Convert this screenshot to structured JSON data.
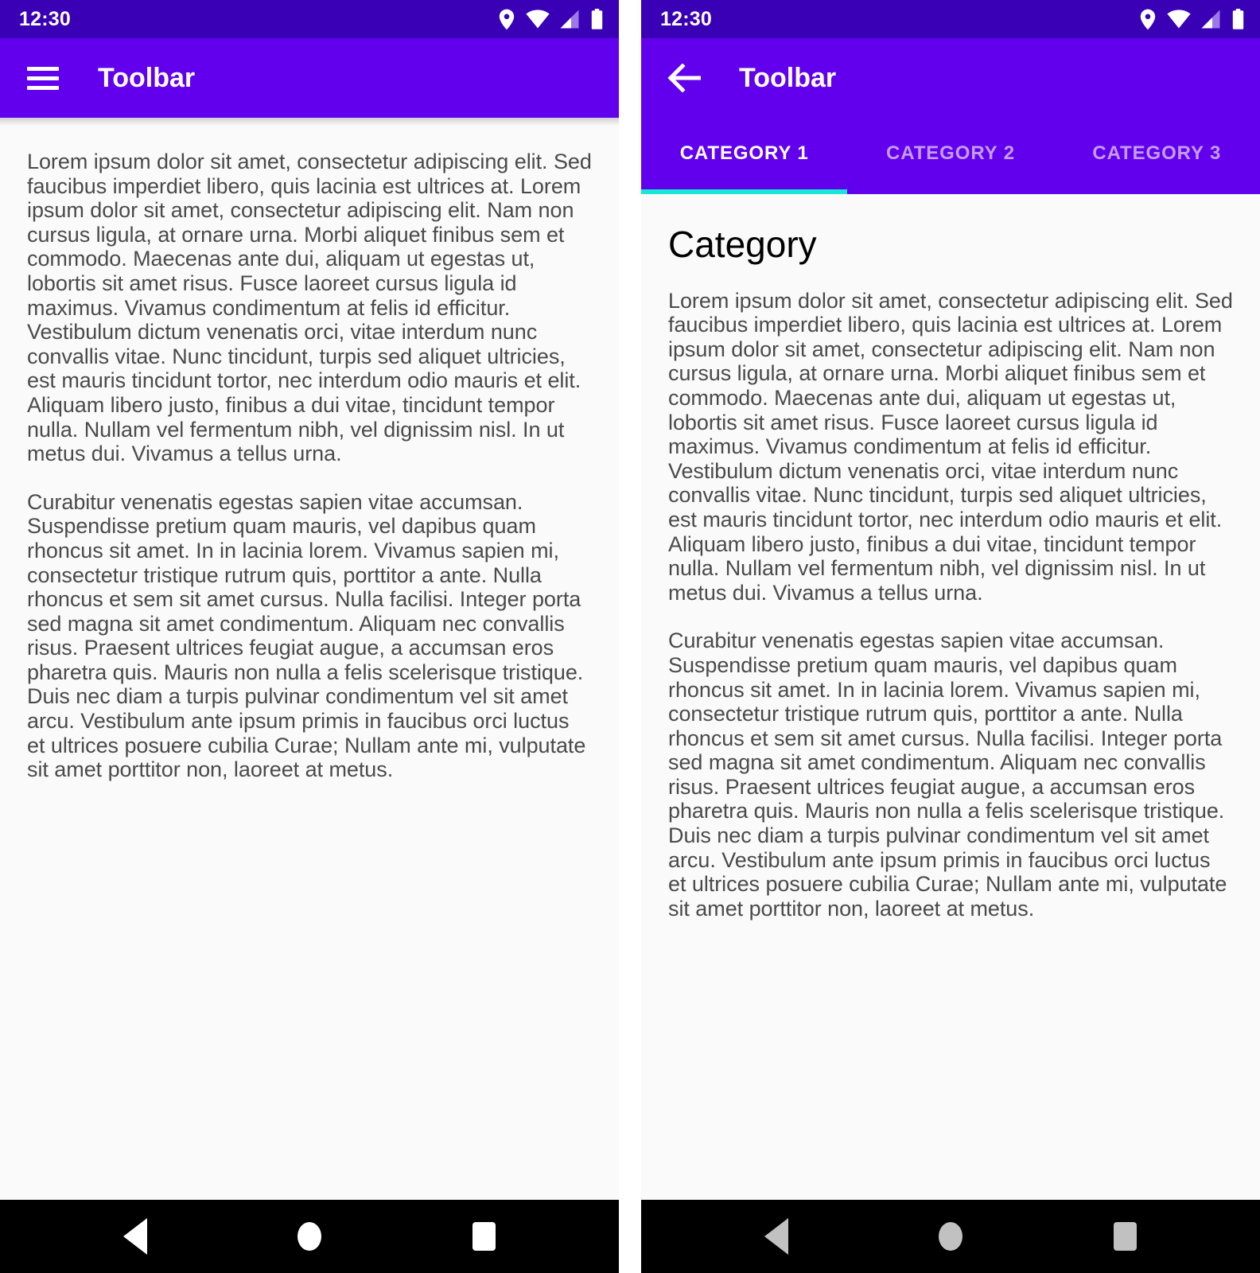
{
  "status_bar": {
    "time": "12:30",
    "icons": [
      "location-pin-icon",
      "wifi-icon",
      "cell-signal-icon",
      "battery-icon"
    ]
  },
  "left_screen": {
    "toolbar": {
      "menu_icon": "hamburger-menu-icon",
      "title": "Toolbar"
    },
    "paragraphs": [
      "Lorem ipsum dolor sit amet, consectetur adipiscing elit. Sed faucibus imperdiet libero, quis lacinia est ultrices at. Lorem ipsum dolor sit amet, consectetur adipiscing elit. Nam non cursus ligula, at ornare urna. Morbi aliquet finibus sem et commodo. Maecenas ante dui, aliquam ut egestas ut, lobortis sit amet risus. Fusce laoreet cursus ligula id maximus. Vivamus condimentum at felis id efficitur. Vestibulum dictum venenatis orci, vitae interdum nunc convallis vitae. Nunc tincidunt, turpis sed aliquet ultricies, est mauris tincidunt tortor, nec interdum odio mauris et elit. Aliquam libero justo, finibus a dui vitae, tincidunt tempor nulla. Nullam vel fermentum nibh, vel dignissim nisl. In ut metus dui. Vivamus a tellus urna.",
      "Curabitur venenatis egestas sapien vitae accumsan. Suspendisse pretium quam mauris, vel dapibus quam rhoncus sit amet. In in lacinia lorem. Vivamus sapien mi, consectetur tristique rutrum quis, porttitor a ante. Nulla rhoncus et sem sit amet cursus. Nulla facilisi. Integer porta sed magna sit amet condimentum. Aliquam nec convallis risus. Praesent ultrices feugiat augue, a accumsan eros pharetra quis. Mauris non nulla a felis scelerisque tristique. Duis nec diam a turpis pulvinar condimentum vel sit amet arcu. Vestibulum ante ipsum primis in faucibus orci luctus et ultrices posuere cubilia Curae; Nullam ante mi, vulputate sit amet porttitor non, laoreet at metus."
    ]
  },
  "right_screen": {
    "toolbar": {
      "back_icon": "arrow-back-icon",
      "title": "Toolbar"
    },
    "tabs": [
      {
        "label": "CATEGORY 1",
        "active": true
      },
      {
        "label": "CATEGORY 2",
        "active": false
      },
      {
        "label": "CATEGORY 3",
        "active": false
      }
    ],
    "heading": "Category",
    "paragraphs": [
      "Lorem ipsum dolor sit amet, consectetur adipiscing elit. Sed faucibus imperdiet libero, quis lacinia est ultrices at. Lorem ipsum dolor sit amet, consectetur adipiscing elit. Nam non cursus ligula, at ornare urna. Morbi aliquet finibus sem et commodo. Maecenas ante dui, aliquam ut egestas ut, lobortis sit amet risus. Fusce laoreet cursus ligula id maximus. Vivamus condimentum at felis id efficitur. Vestibulum dictum venenatis orci, vitae interdum nunc convallis vitae. Nunc tincidunt, turpis sed aliquet ultricies, est mauris tincidunt tortor, nec interdum odio mauris et elit. Aliquam libero justo, finibus a dui vitae, tincidunt tempor nulla. Nullam vel fermentum nibh, vel dignissim nisl. In ut metus dui. Vivamus a tellus urna.",
      "Curabitur venenatis egestas sapien vitae accumsan. Suspendisse pretium quam mauris, vel dapibus quam rhoncus sit amet. In in lacinia lorem. Vivamus sapien mi, consectetur tristique rutrum quis, porttitor a ante. Nulla rhoncus et sem sit amet cursus. Nulla facilisi. Integer porta sed magna sit amet condimentum. Aliquam nec convallis risus. Praesent ultrices feugiat augue, a accumsan eros pharetra quis. Mauris non nulla a felis scelerisque tristique. Duis nec diam a turpis pulvinar condimentum vel sit amet arcu. Vestibulum ante ipsum primis in faucibus orci luctus et ultrices posuere cubilia Curae; Nullam ante mi, vulputate sit amet porttitor non, laoreet at metus."
    ]
  },
  "system_nav": {
    "buttons": [
      "back-nav-icon",
      "home-nav-icon",
      "recents-nav-icon"
    ]
  },
  "colors": {
    "status_bar_purple": "#3a00b5",
    "toolbar_purple": "#6200ee",
    "tab_indicator_cyan": "#18e7d6",
    "content_background": "#fafafa",
    "body_text": "#4a4a4a",
    "nav_glyph_left": "#ffffff",
    "nav_glyph_right": "#c1c1c1"
  }
}
